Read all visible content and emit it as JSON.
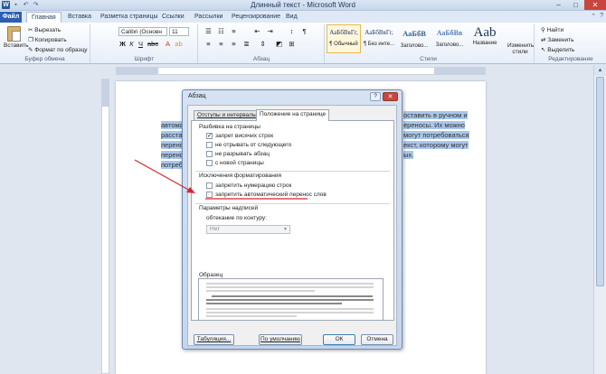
{
  "window": {
    "title": "Длинный текст - Microsoft Word",
    "min": "–",
    "max": "□",
    "close": "✕"
  },
  "ribbon_tabs": [
    "Файл",
    "Главная",
    "Вставка",
    "Разметка страницы",
    "Ссылки",
    "Рассылки",
    "Рецензирование",
    "Вид"
  ],
  "ribbon": {
    "clipboard": {
      "paste": "Вставить",
      "cut": "Вырезать",
      "copy": "Копировать",
      "format_painter": "Формат по образцу",
      "label": "Буфер обмена"
    },
    "font": {
      "name": "Calibri (Основн",
      "size": "11",
      "label": "Шрифт"
    },
    "paragraph": {
      "label": "Абзац"
    },
    "styles": {
      "items": [
        {
          "sample": "АаБбВвГг,",
          "name": "¶ Обычный"
        },
        {
          "sample": "АаБбВвГг,",
          "name": "¶ Без инте..."
        },
        {
          "sample": "АаБбВ",
          "name": "Заголово..."
        },
        {
          "sample": "АаБбВв",
          "name": "Заголово..."
        },
        {
          "sample": "Aab",
          "name": "Название"
        }
      ],
      "change": "Изменить стили",
      "label": "Стили"
    },
    "editing": {
      "find": "Найти",
      "replace": "Заменить",
      "select": "Выделить",
      "label": "Редактирование"
    }
  },
  "document": {
    "lines": [
      {
        "left": "автома",
        "right": "оставить в ручном и"
      },
      {
        "left": "расста",
        "right": "ереносы. Их можно"
      },
      {
        "left": "перено",
        "right": "могут потребоваться"
      },
      {
        "left": "перено",
        "right": "екст, которому могут"
      },
      {
        "left": "потреб",
        "right": "ых."
      }
    ]
  },
  "dialog": {
    "title": "Абзац",
    "help": "?",
    "close": "✕",
    "tabs": [
      "Отступы и интервалы",
      "Положение на странице"
    ],
    "pagination": {
      "heading": "Разбивка на страницы",
      "options": [
        {
          "label": "запрет висячих строк",
          "checked": true
        },
        {
          "label": "не отрывать от следующего",
          "checked": false
        },
        {
          "label": "не разрывать абзац",
          "checked": false
        },
        {
          "label": "с новой страницы",
          "checked": false
        }
      ]
    },
    "exceptions": {
      "heading": "Исключения форматирования",
      "options": [
        {
          "label": "запретить нумерацию строк",
          "checked": false
        },
        {
          "label": "запретить автоматический перенос слов",
          "checked": false
        }
      ]
    },
    "textbox": {
      "heading": "Параметры надписей",
      "wrap_label": "обтекание по контуру:",
      "wrap_value": "Нет"
    },
    "preview": {
      "heading": "Образец"
    },
    "buttons": {
      "tabs": "Табуляция...",
      "default": "По умолчанию",
      "ok": "ОК",
      "cancel": "Отмена"
    }
  },
  "colors": {
    "annotation": "#d6262e",
    "selection": "#a9c6ea"
  }
}
